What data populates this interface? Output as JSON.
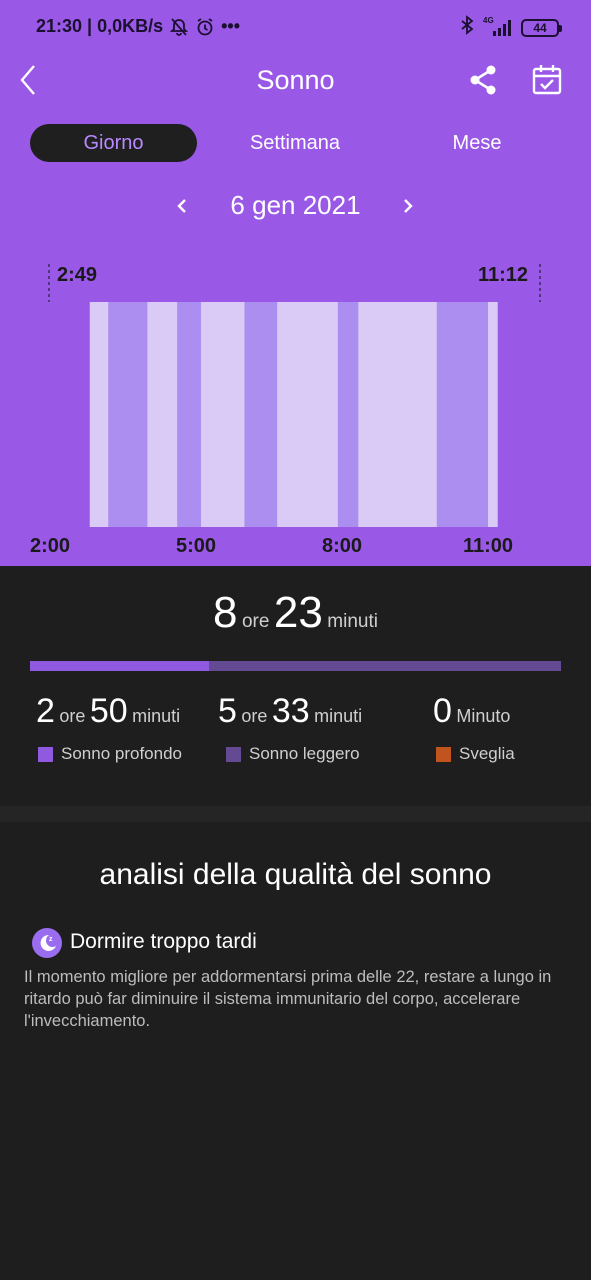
{
  "status_bar": {
    "time_speed": "21:30 | 0,0KB/s",
    "more": "•••",
    "network": "4G",
    "battery": "44"
  },
  "header": {
    "title": "Sonno",
    "back_icon": "back-chevron-icon",
    "share_icon": "share-icon",
    "calendar_icon": "calendar-check-icon"
  },
  "tabs": [
    {
      "label": "Giorno",
      "active": true
    },
    {
      "label": "Settimana",
      "active": false
    },
    {
      "label": "Mese",
      "active": false
    }
  ],
  "date_nav": {
    "date": "6 gen 2021"
  },
  "chart_data": {
    "type": "bar",
    "start_label": "2:49",
    "end_label": "11:12",
    "x_ticks": [
      "2:00",
      "5:00",
      "8:00",
      "11:00"
    ],
    "segments": [
      {
        "start": "2:49",
        "end": "3:12",
        "stage": "leggero"
      },
      {
        "start": "3:12",
        "end": "4:00",
        "stage": "profondo"
      },
      {
        "start": "4:00",
        "end": "4:37",
        "stage": "leggero"
      },
      {
        "start": "4:37",
        "end": "5:06",
        "stage": "profondo"
      },
      {
        "start": "5:06",
        "end": "6:00",
        "stage": "leggero"
      },
      {
        "start": "6:00",
        "end": "6:40",
        "stage": "profondo"
      },
      {
        "start": "6:40",
        "end": "7:55",
        "stage": "leggero"
      },
      {
        "start": "7:55",
        "end": "8:20",
        "stage": "profondo"
      },
      {
        "start": "8:20",
        "end": "9:57",
        "stage": "leggero"
      },
      {
        "start": "9:57",
        "end": "11:00",
        "stage": "profondo"
      },
      {
        "start": "11:00",
        "end": "11:12",
        "stage": "leggero"
      }
    ],
    "colors": {
      "profondo": "#ab8ef0",
      "leggero": "#d9cbf5",
      "background": "#9a58e6"
    }
  },
  "summary": {
    "total_hours": "8",
    "hours_unit": "ore",
    "total_minutes": "23",
    "minutes_unit": "minuti",
    "deep_fraction": 0.338
  },
  "stats": [
    {
      "h": "2",
      "h_unit": "ore",
      "m": "50",
      "m_unit": "minuti",
      "label": "Sonno profondo",
      "color": "#8f5ae0"
    },
    {
      "h": "5",
      "h_unit": "ore",
      "m": "33",
      "m_unit": "minuti",
      "label": "Sonno leggero",
      "color": "#644a92"
    },
    {
      "m": "0",
      "m_unit": "Minuto",
      "label": "Sveglia",
      "color": "#c0541e"
    }
  ],
  "analysis": {
    "title": "analisi della qualità del sonno",
    "tip_icon": "moon-icon",
    "tip_title": "Dormire troppo tardi",
    "tip_text": "Il momento migliore per addormentarsi prima delle 22, restare a lungo in ritardo può far diminuire il sistema immunitario del corpo, accelerare l'invecchiamento."
  }
}
